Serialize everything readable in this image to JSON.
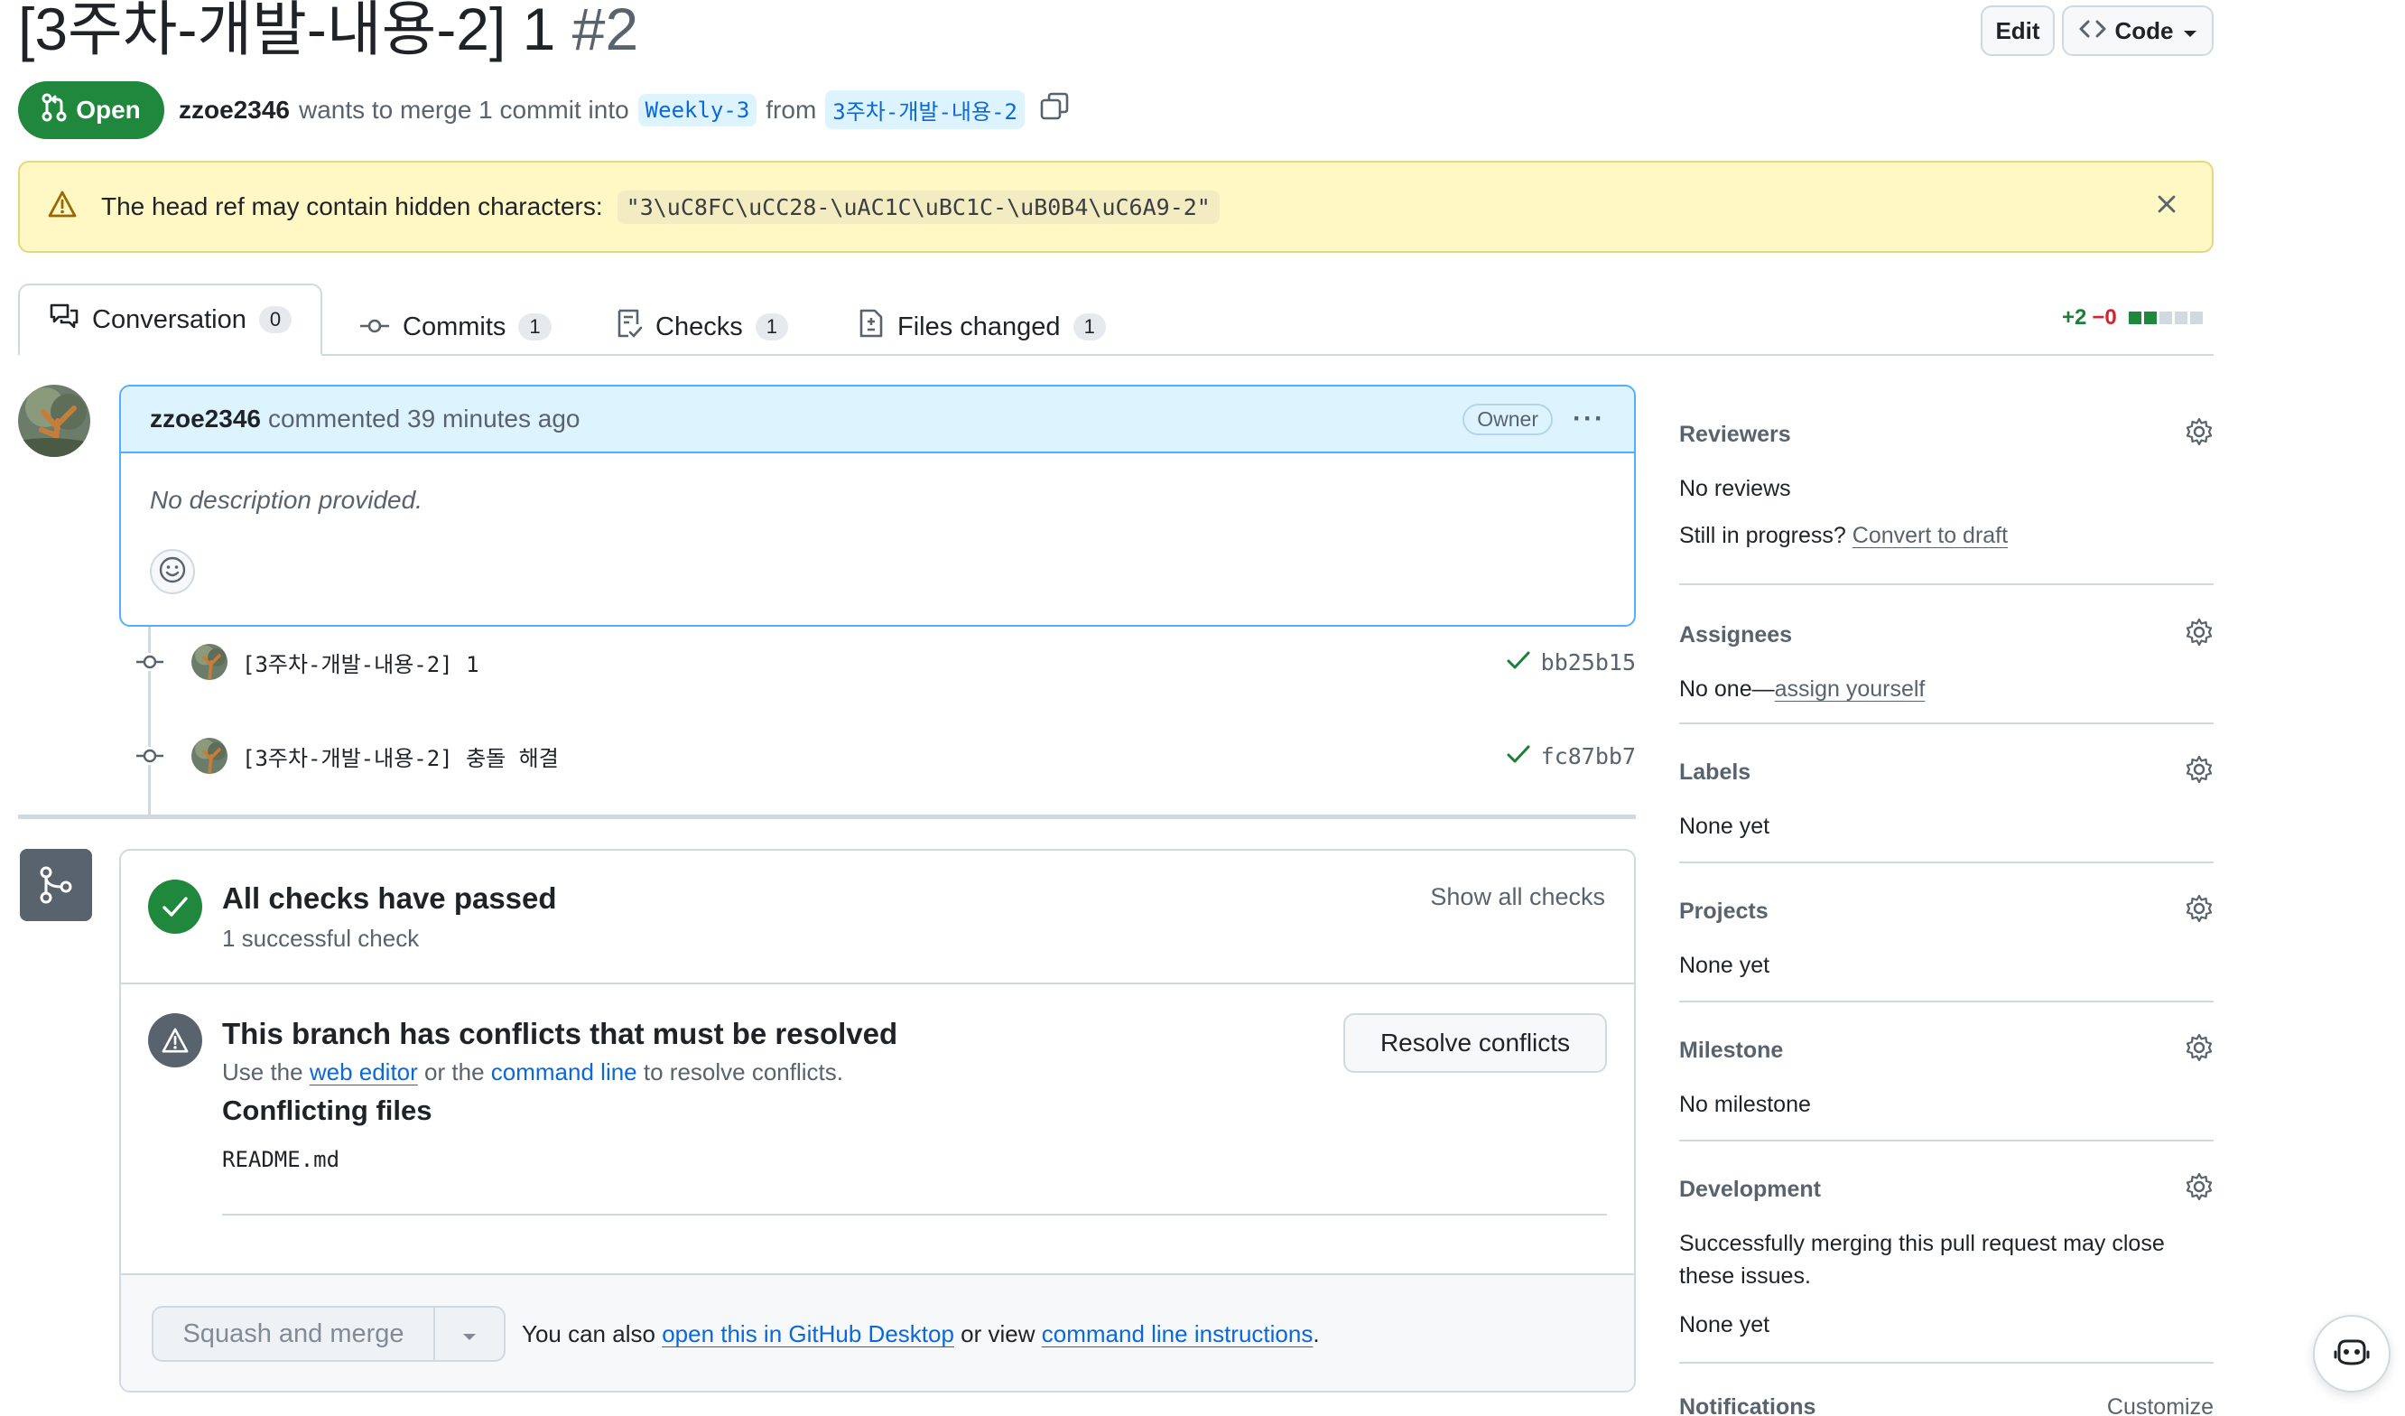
{
  "header": {
    "title": "[3주차-개발-내용-2] 1",
    "number": "#2",
    "edit_label": "Edit",
    "code_label": "Code"
  },
  "state": {
    "label": "Open"
  },
  "meta": {
    "author": "zzoe2346",
    "text1": "wants to merge 1 commit into",
    "base_branch": "Weekly-3",
    "text2": "from",
    "head_branch": "3주차-개발-내용-2"
  },
  "warning": {
    "text": "The head ref may contain hidden characters:",
    "code": "\"3\\uC8FC\\uCC28-\\uAC1C\\uBC1C-\\uB0B4\\uC6A9-2\""
  },
  "tabs": [
    {
      "label": "Conversation",
      "count": "0"
    },
    {
      "label": "Commits",
      "count": "1"
    },
    {
      "label": "Checks",
      "count": "1"
    },
    {
      "label": "Files changed",
      "count": "1"
    }
  ],
  "diffstat": {
    "additions": "+2",
    "deletions": "−0"
  },
  "comment": {
    "author": "zzoe2346",
    "action": "commented 39 minutes ago",
    "role": "Owner",
    "body": "No description provided."
  },
  "commits": [
    {
      "message": "[3주차-개발-내용-2] 1",
      "sha": "bb25b15"
    },
    {
      "message": "[3주차-개발-내용-2] 충돌 해결",
      "sha": "fc87bb7"
    }
  ],
  "merge": {
    "checks_title": "All checks have passed",
    "checks_sub": "1 successful check",
    "show_checks": "Show all checks",
    "conflict_title": "This branch has conflicts that must be resolved",
    "conflict_sub_1": "Use the",
    "conflict_link_1": "web editor",
    "conflict_sub_2": "or the",
    "conflict_link_2": "command line",
    "conflict_sub_3": "to resolve conflicts.",
    "conflicting_title": "Conflicting files",
    "conflicting_file": "README.md",
    "resolve_label": "Resolve conflicts",
    "squash_label": "Squash and merge",
    "also_1": "You can also",
    "also_link_1": "open this in GitHub Desktop",
    "also_2": "or view",
    "also_link_2": "command line instructions",
    "also_3": "."
  },
  "sidebar": {
    "reviewers": {
      "title": "Reviewers",
      "text": "No reviews",
      "progress": "Still in progress?",
      "draft_link": "Convert to draft"
    },
    "assignees": {
      "title": "Assignees",
      "text": "No one—",
      "link": "assign yourself"
    },
    "labels": {
      "title": "Labels",
      "text": "None yet"
    },
    "projects": {
      "title": "Projects",
      "text": "None yet"
    },
    "milestone": {
      "title": "Milestone",
      "text": "No milestone"
    },
    "development": {
      "title": "Development",
      "text": "Successfully merging this pull request may close these issues.",
      "text2": "None yet"
    },
    "notifications": {
      "title": "Notifications",
      "link": "Customize"
    }
  },
  "colors": {
    "open_green": "#1f883d",
    "link_blue": "#0969da",
    "warning_bg": "#fff8c5",
    "comment_header_bg": "#ddf4ff"
  }
}
